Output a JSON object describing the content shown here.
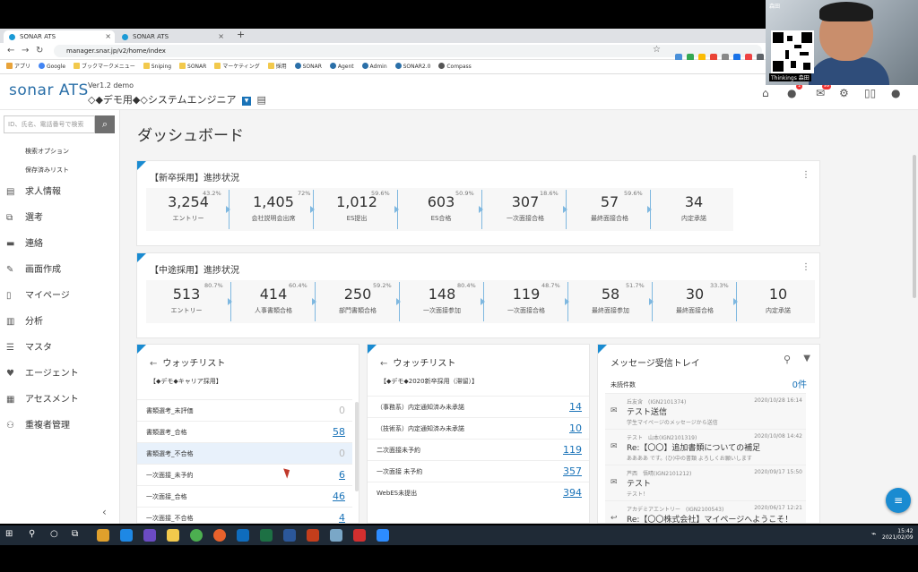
{
  "browser": {
    "tabs": [
      {
        "label": "SONAR ATS"
      },
      {
        "label": "SONAR ATS"
      }
    ],
    "url": "manager.snar.jp/v2/home/index",
    "bookmarks": [
      "アプリ",
      "Google",
      "ブックマークメニュー",
      "Sniping",
      "SONAR",
      "マーケティング",
      "採用",
      "SONAR",
      "Agent",
      "Admin",
      "SONAR2.0",
      "Compass"
    ]
  },
  "header": {
    "logo": "sonar ATS",
    "version": "Ver1.2 demo",
    "project": "◇◆デモ用◆◇システムエンジニア",
    "notif_count": "2",
    "message_count": "99"
  },
  "webcam": {
    "name": "森田",
    "label": "Thinkings 森田"
  },
  "sidebar": {
    "search_placeholder": "ID、氏名、電話番号で検索",
    "sublinks": [
      "検索オプション",
      "保存済みリスト"
    ],
    "items": [
      "求人情報",
      "選考",
      "連絡",
      "画面作成",
      "マイページ",
      "分析",
      "マスタ",
      "エージェント",
      "アセスメント",
      "重複者管理"
    ]
  },
  "main": {
    "title": "ダッシュボード",
    "new_grad": {
      "title": "【新卒採用】進捗状況",
      "stages": [
        {
          "num": "3,254",
          "label": "エントリー"
        },
        {
          "num": "1,405",
          "label": "会社説明会出席"
        },
        {
          "num": "1,012",
          "label": "ES提出"
        },
        {
          "num": "603",
          "label": "ES合格"
        },
        {
          "num": "307",
          "label": "一次面接合格"
        },
        {
          "num": "57",
          "label": "最終面接合格"
        },
        {
          "num": "34",
          "label": "内定承諾"
        }
      ],
      "rates": [
        "43.2%",
        "72%",
        "59.6%",
        "50.9%",
        "18.6%",
        "59.6%"
      ]
    },
    "mid_career": {
      "title": "【中途採用】進捗状況",
      "stages": [
        {
          "num": "513",
          "label": "エントリー"
        },
        {
          "num": "414",
          "label": "人事書類合格"
        },
        {
          "num": "250",
          "label": "部門書類合格"
        },
        {
          "num": "148",
          "label": "一次面接参加"
        },
        {
          "num": "119",
          "label": "一次面接合格"
        },
        {
          "num": "58",
          "label": "最終面接参加"
        },
        {
          "num": "30",
          "label": "最終面接合格"
        },
        {
          "num": "10",
          "label": "内定承諾"
        }
      ],
      "rates": [
        "80.7%",
        "60.4%",
        "59.2%",
        "80.4%",
        "48.7%",
        "51.7%",
        "33.3%"
      ]
    },
    "watch1": {
      "title": "ウォッチリスト",
      "subtitle": "【◆デモ◆キャリア採用】",
      "rows": [
        {
          "label": "書類選考_未評価",
          "count": "0"
        },
        {
          "label": "書類選考_合格",
          "count": "58"
        },
        {
          "label": "書類選考_不合格",
          "count": "0"
        },
        {
          "label": "一次面接_未予約",
          "count": "6"
        },
        {
          "label": "一次面接_合格",
          "count": "46"
        },
        {
          "label": "一次面接_不合格",
          "count": "4"
        }
      ]
    },
    "watch2": {
      "title": "ウォッチリスト",
      "subtitle": "【◆デモ◆2020新卒採用（滞留）】",
      "rows": [
        {
          "label": "（事務系）内定通知済み未承諾",
          "count": "14"
        },
        {
          "label": "（技術系）内定通知済み未承諾",
          "count": "10"
        },
        {
          "label": "二次面接未予約",
          "count": "119"
        },
        {
          "label": "一次面接 未予約",
          "count": "357"
        },
        {
          "label": "WebES未提出",
          "count": "394"
        }
      ]
    },
    "inbox": {
      "title": "メッセージ受信トレイ",
      "unread_label": "未読件数",
      "unread_count": "0件",
      "messages": [
        {
          "from": "丘友含　(IGN2101374)",
          "date": "2020/10/28 16:14",
          "subject": "テスト送信",
          "preview": "学生マイページのメッセージから送信"
        },
        {
          "from": "テスト　山本(IGN2101319)",
          "date": "2020/10/08 14:42",
          "subject": "Re:【〇〇】追加書類についての補足",
          "preview": "ああああ です。(ひ)中の書類 よろしくお願いします"
        },
        {
          "from": "芦西　悟晴(IGN2101212)",
          "date": "2020/09/17 15:50",
          "subject": "テスト",
          "preview": "テスト！"
        },
        {
          "from": "アカデミアエントリー　(IGN2100543)",
          "date": "2020/06/17 12:21",
          "subject": "Re:【〇〇株式会社】マイページへようこそ！",
          "preview": ""
        }
      ]
    }
  },
  "taskbar": {
    "time": "15:42",
    "date": "2021/02/09"
  },
  "colors": {
    "accent": "#1a8bd1",
    "link": "#1a73b8"
  }
}
